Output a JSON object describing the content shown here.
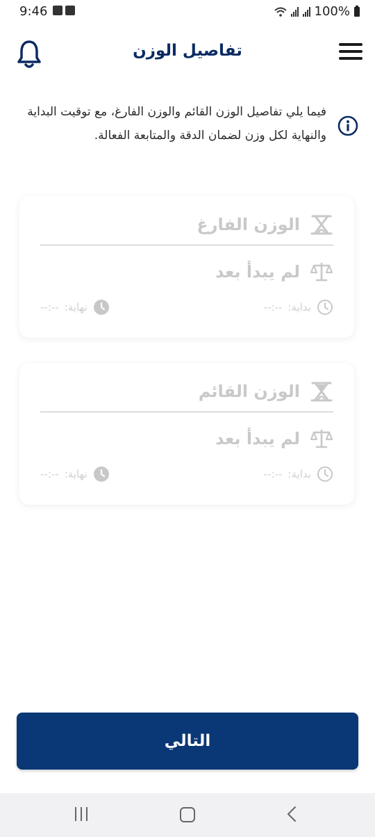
{
  "status_bar": {
    "time": "9:46",
    "battery": "100%"
  },
  "header": {
    "title": "تفاصيل الوزن",
    "icons": {
      "left": "bell-icon",
      "right": "hamburger-menu-icon"
    }
  },
  "info": {
    "icon": "info-icon",
    "text": "فيما يلي تفاصيل الوزن القائم والوزن الفارغ، مع توقيت البداية والنهاية لكل وزن لضمان الدقة والمتابعة الفعالة."
  },
  "cards": [
    {
      "title": "الوزن الفارغ",
      "status": "لم يبدأ بعد",
      "start_label": "بداية:",
      "start_value": "--:--",
      "end_label": "نهاية:",
      "end_value": "--:--",
      "icons": [
        "empty-scale-icon",
        "balance-icon",
        "clock-outline-icon",
        "clock-filled-icon"
      ]
    },
    {
      "title": "الوزن القائم",
      "status": "لم يبدأ بعد",
      "start_label": "بداية:",
      "start_value": "--:--",
      "end_label": "نهاية:",
      "end_value": "--:--",
      "icons": [
        "loaded-scale-icon",
        "balance-icon",
        "clock-outline-icon",
        "clock-filled-icon"
      ]
    }
  ],
  "next_button": {
    "label": "التالي"
  },
  "colors": {
    "primary": "#0a3776",
    "title": "#0b2b63",
    "disabled_text": "#c9c9c9",
    "nav_bar": "#f1f1f4"
  }
}
